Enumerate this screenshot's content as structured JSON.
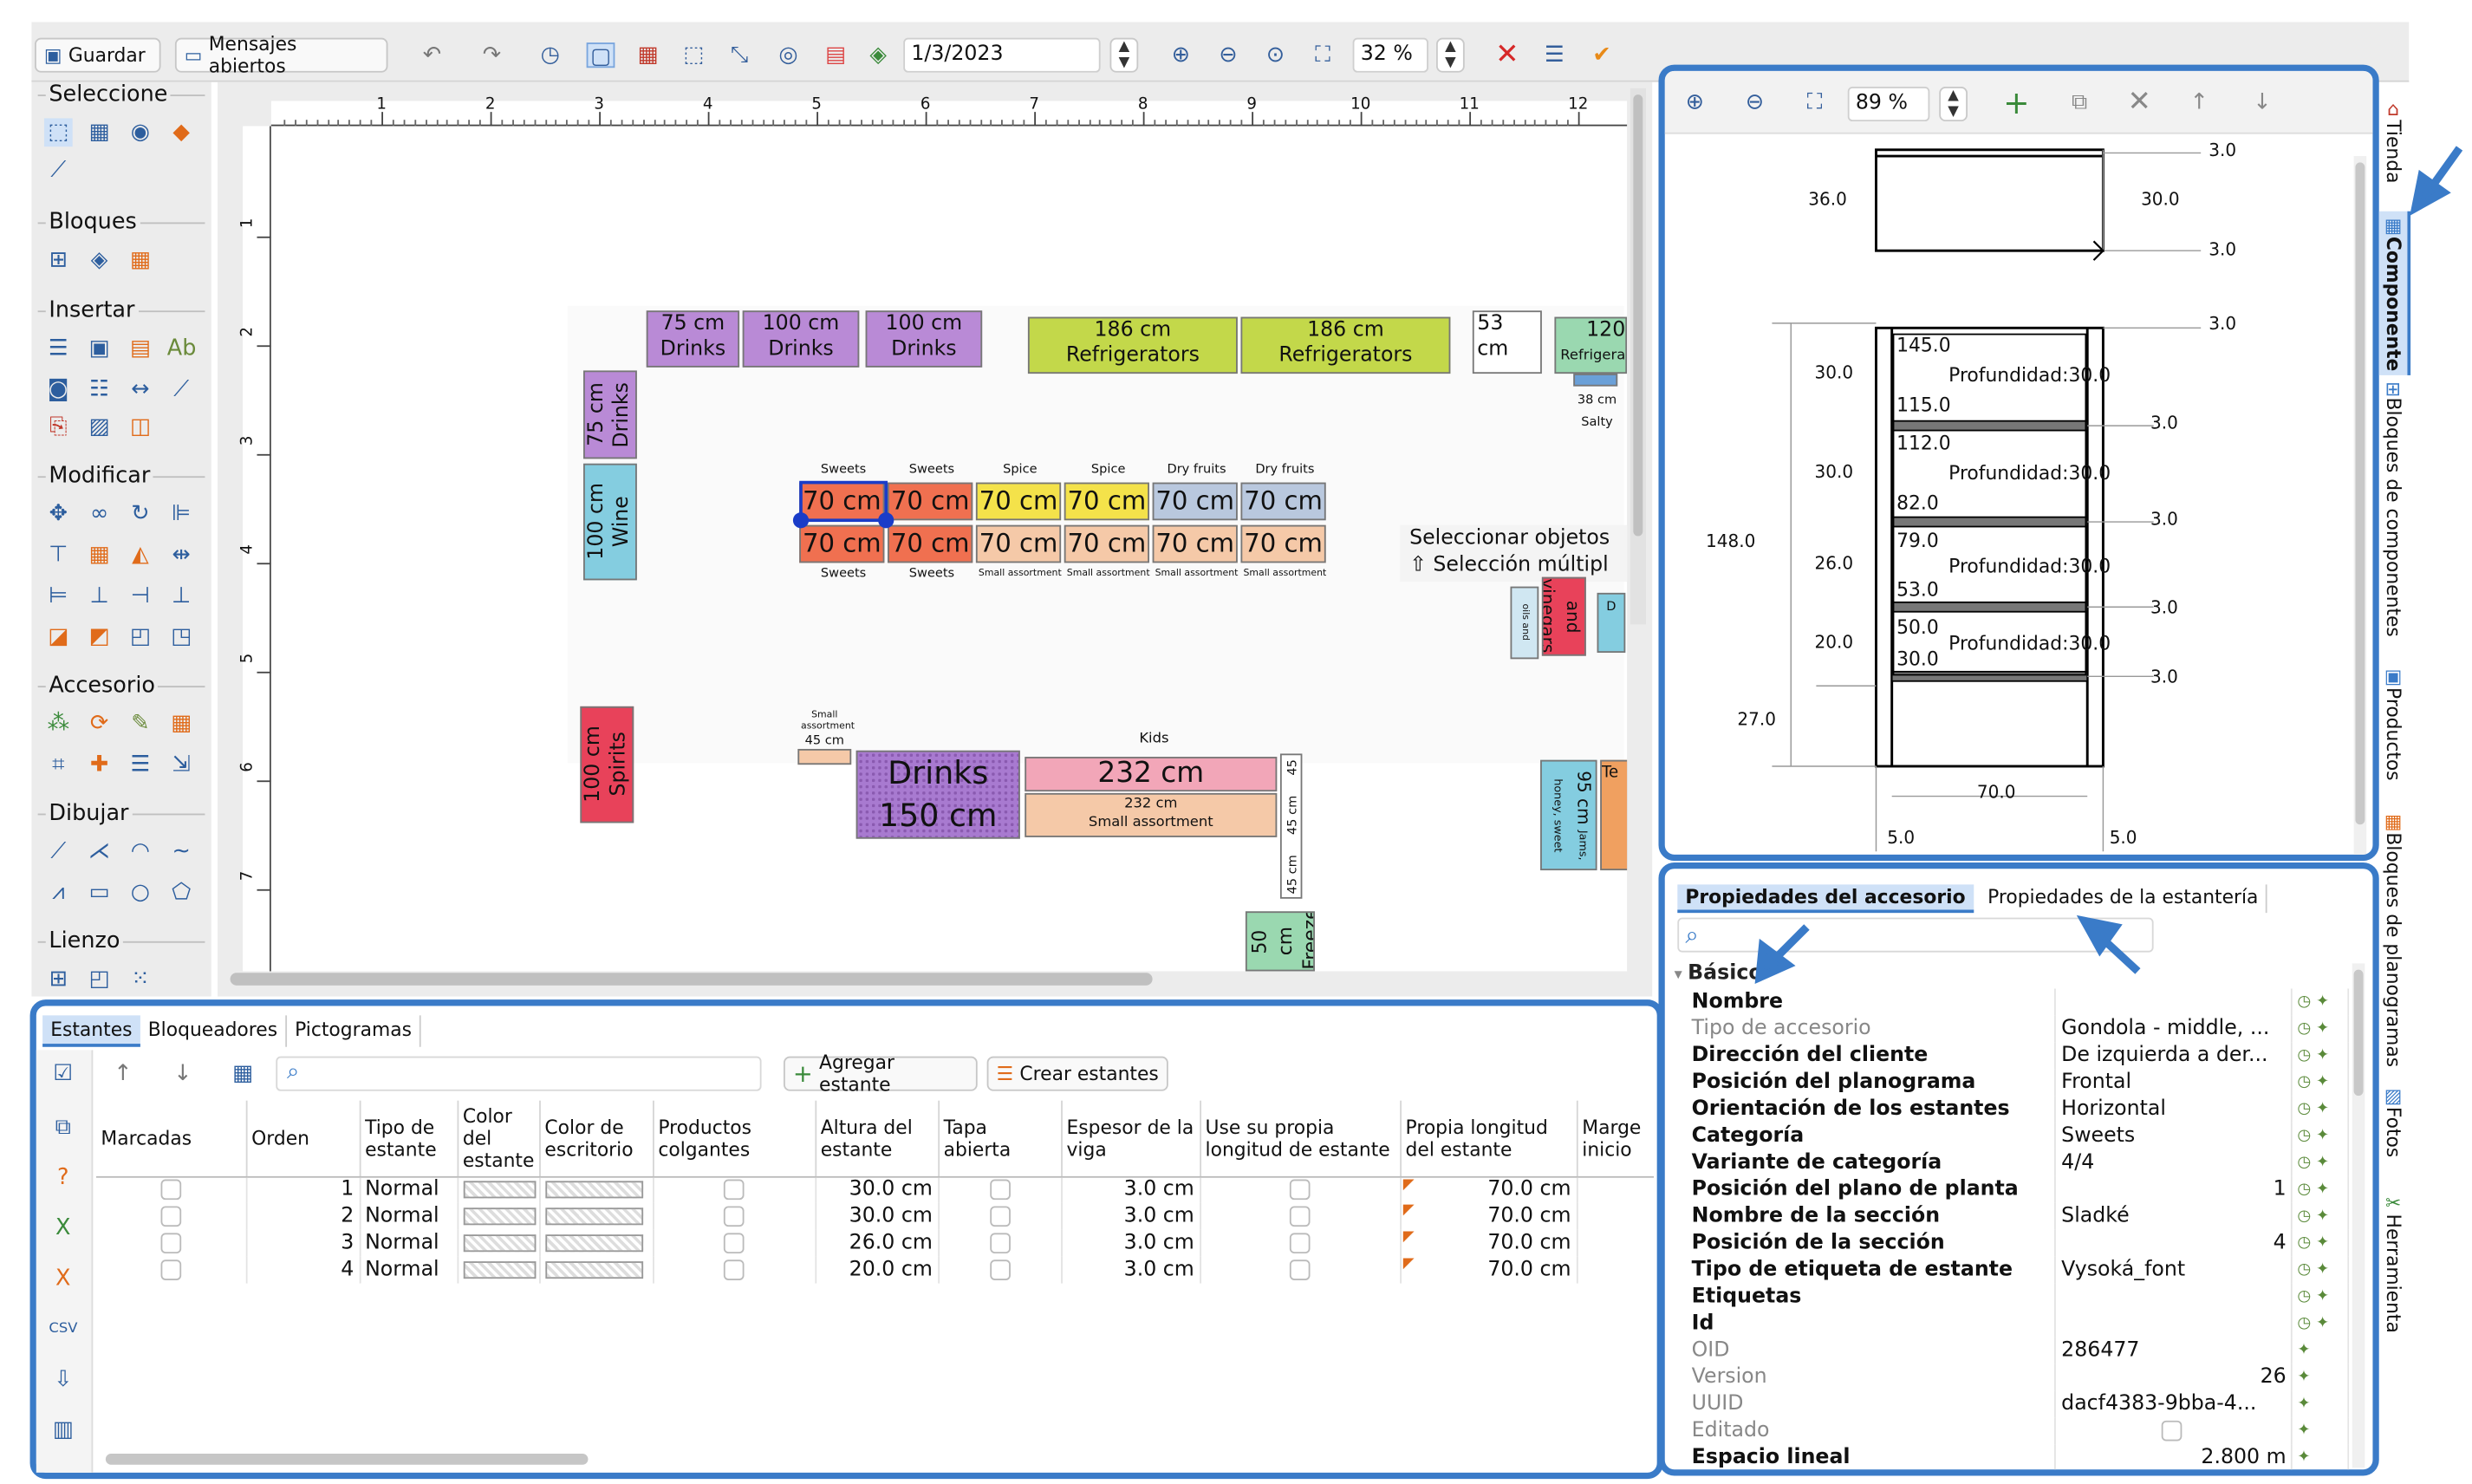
{
  "toolbar": {
    "save_label": "Guardar",
    "messages_label": "Mensajes abiertos",
    "date_value": "1/3/2023",
    "zoom_value": "32 %"
  },
  "palette": {
    "groups": [
      "Seleccione",
      "Bloques",
      "Insertar",
      "Modificar",
      "Accesorio",
      "Dibujar",
      "Lienzo"
    ]
  },
  "ruler": {
    "ticks": [
      "1",
      "2",
      "3",
      "4",
      "5",
      "6",
      "7",
      "8",
      "9",
      "10",
      "11",
      "12"
    ],
    "vticks": [
      "1",
      "2",
      "3",
      "4",
      "5",
      "6",
      "7"
    ]
  },
  "canvas": {
    "fixtures": [
      {
        "a": "75 cm",
        "b": "Drinks"
      },
      {
        "a": "100 cm",
        "b": "Drinks"
      },
      {
        "a": "100 cm",
        "b": "Drinks"
      },
      {
        "a": "186 cm",
        "b": "Refrigerators"
      },
      {
        "a": "186 cm",
        "b": "Refrigerators"
      },
      {
        "a": "53 cm",
        "b": ""
      },
      {
        "a": "120",
        "b": "Refrigera"
      },
      {
        "a": "75 cm",
        "b": "Drinks"
      },
      {
        "a": "100 cm",
        "b": "Wine"
      },
      {
        "a": "100 cm",
        "b": "Spirits"
      },
      {
        "a": "Drinks",
        "b": "150 cm"
      },
      {
        "a": "232 cm",
        "b": ""
      },
      {
        "a": "232 cm",
        "b": "Small assortment"
      },
      {
        "a": "50 cm",
        "b": "Freezer"
      },
      {
        "a": "95 cm",
        "b": ""
      },
      {
        "a": "95 cm",
        "b": "Te"
      }
    ],
    "gondola_top_cats": [
      "Sweets",
      "Sweets",
      "Spice",
      "Spice",
      "Dry fruits",
      "Dry fruits"
    ],
    "gondola_bottom_cats": [
      "Sweets",
      "Sweets",
      "Small assortment",
      "Small assortment",
      "Small assortment",
      "Small assortment"
    ],
    "gondola_cell": "70 cm",
    "small_labels": {
      "salty": "Salty",
      "cm38": "38 cm",
      "kids": "Kids",
      "small_assort": "Small assortment",
      "cm45": "45 cm",
      "oil": "and vinegars",
      "jams": "Jams, honey, sweet creams",
      "d": "D",
      "e": "E",
      "oil2": "oils and dressings"
    },
    "tooltip_line1": "Seleccionar objetos",
    "tooltip_line2": "⇧ Selección múltipl"
  },
  "shelves_panel": {
    "tabs": [
      "Estantes",
      "Bloqueadores",
      "Pictogramas"
    ],
    "add_label": "Agregar estante",
    "create_label": "Crear estantes",
    "columns": [
      "Marcadas",
      "Orden",
      "Tipo de estante",
      "Color del estante",
      "Color de escritorio",
      "Productos colgantes",
      "Altura del estante",
      "Tapa abierta",
      "Espesor de la viga",
      "Use su propia longitud de estante",
      "Propia longitud del estante",
      "Marge inicio"
    ],
    "rows": [
      {
        "order": "1",
        "type": "Normal",
        "height": "30.0 cm",
        "beam": "3.0 cm",
        "length": "70.0 cm"
      },
      {
        "order": "2",
        "type": "Normal",
        "height": "30.0 cm",
        "beam": "3.0 cm",
        "length": "70.0 cm"
      },
      {
        "order": "3",
        "type": "Normal",
        "height": "26.0 cm",
        "beam": "3.0 cm",
        "length": "70.0 cm"
      },
      {
        "order": "4",
        "type": "Normal",
        "height": "20.0 cm",
        "beam": "3.0 cm",
        "length": "70.0 cm"
      }
    ]
  },
  "drawing_panel": {
    "zoom_value": "89 %",
    "dims": {
      "d36": "36.0",
      "d30": "30.0",
      "d3": "3.0",
      "d148": "148.0",
      "d27": "27.0",
      "d26": "26.0",
      "d20": "20.0",
      "d70": "70.0",
      "d5": "5.0",
      "s145": "145.0",
      "s115": "115.0",
      "s112": "112.0",
      "s82": "82.0",
      "s79": "79.0",
      "s53": "53.0",
      "s50": "50.0",
      "s30": "30.0",
      "depth": "Profundidad:30.0"
    }
  },
  "props_panel": {
    "tabs": [
      "Propiedades del accesorio",
      "Propiedades de la estantería"
    ],
    "section": "Básico",
    "rows": [
      {
        "k": "Nombre",
        "v": "",
        "dim": false
      },
      {
        "k": "Tipo de accesorio",
        "v": "Gondola - middle, ...",
        "dim": true
      },
      {
        "k": "Dirección del cliente",
        "v": "De izquierda a der...",
        "dim": false
      },
      {
        "k": "Posición del planograma",
        "v": "Frontal",
        "dim": false
      },
      {
        "k": "Orientación de los estantes",
        "v": "Horizontal",
        "dim": false
      },
      {
        "k": "Categoría",
        "v": "Sweets",
        "dim": false
      },
      {
        "k": "Variante de categoría",
        "v": "4/4",
        "dim": false
      },
      {
        "k": "Posición del plano de planta",
        "v": "1",
        "dim": false,
        "right": true
      },
      {
        "k": "Nombre de la sección",
        "v": "Sladké",
        "dim": false
      },
      {
        "k": "Posición de la sección",
        "v": "4",
        "dim": false,
        "right": true
      },
      {
        "k": "Tipo de etiqueta de estante",
        "v": "Vysoká_font",
        "dim": false
      },
      {
        "k": "Etiquetas",
        "v": "",
        "dim": false
      },
      {
        "k": "Id",
        "v": "",
        "dim": false
      },
      {
        "k": "OID",
        "v": "286477",
        "dim": true
      },
      {
        "k": "Version",
        "v": "26",
        "dim": true,
        "right": true
      },
      {
        "k": "UUID",
        "v": "dacf4383-9bba-4...",
        "dim": true
      },
      {
        "k": "Editado",
        "v": "",
        "dim": true
      },
      {
        "k": "Espacio lineal",
        "v": "2.800 m",
        "dim": false,
        "right": true
      }
    ]
  },
  "side_tabs": [
    "Tienda",
    "Componente",
    "Bloques de componentes",
    "Productos",
    "Bloques de planogramas",
    "Fotos",
    "Herramienta"
  ],
  "colors": {
    "accent": "#3a7bc8",
    "drinks": "#b98ad6",
    "refrig": "#c3d84a",
    "wine": "#84cde0",
    "spirits": "#e8425a",
    "kids": "#f2a6b8"
  }
}
